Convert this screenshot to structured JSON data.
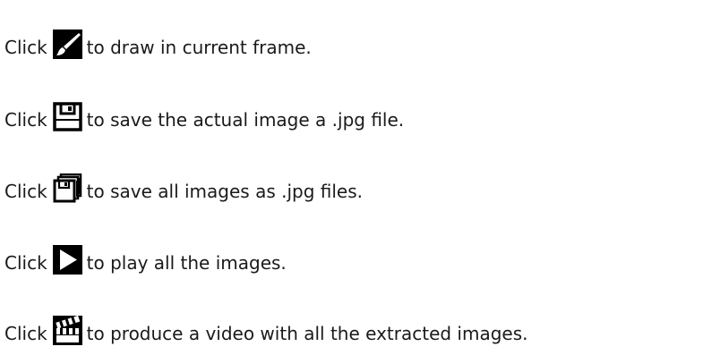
{
  "colors": {
    "text": "#1a1a1a",
    "icon": "#000000",
    "background": "#ffffff"
  },
  "instructions": [
    {
      "prefix": "Click",
      "icon": "brush-icon",
      "text": "to draw in current frame."
    },
    {
      "prefix": "Click",
      "icon": "floppy-disk-icon",
      "text": "to save the actual image a .jpg file."
    },
    {
      "prefix": "Click",
      "icon": "multiple-floppy-disks-icon",
      "text": "to save all images as .jpg files."
    },
    {
      "prefix": "Click",
      "icon": "play-icon",
      "text": "to play all the images."
    },
    {
      "prefix": "Click",
      "icon": "clapperboard-icon",
      "text": "to produce a video with all the extracted images."
    }
  ]
}
